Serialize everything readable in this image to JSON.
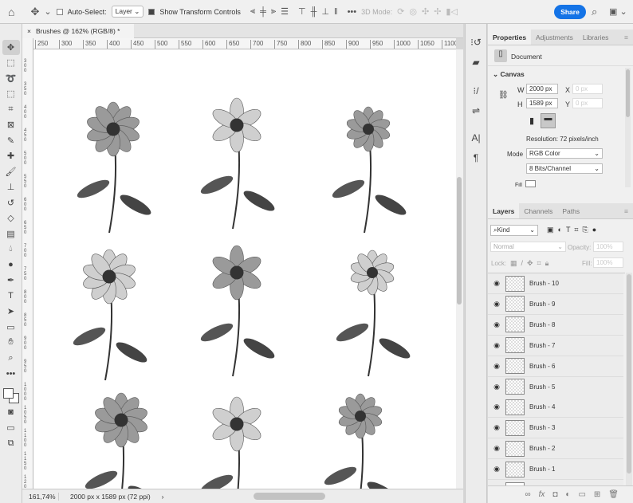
{
  "topbar": {
    "auto_select_label": "Auto-Select:",
    "auto_select_checked": false,
    "layer_select": "Layer",
    "show_transform_label": "Show Transform Controls",
    "show_transform_checked": true,
    "mode_3d_label": "3D Mode:",
    "share_label": "Share"
  },
  "document": {
    "tab_title": "Brushes @ 162% (RGB/8) *",
    "zoom": "161,74%",
    "info": "2000 px x 1589 px (72 ppi)"
  },
  "rulers": {
    "horizontal": [
      "250",
      "300",
      "350",
      "400",
      "450",
      "500",
      "550",
      "600",
      "650",
      "700",
      "750",
      "800",
      "850",
      "900",
      "950",
      "1000",
      "1050",
      "1100"
    ],
    "vertical": [
      "300",
      "350",
      "400",
      "450",
      "500",
      "550",
      "600",
      "650",
      "700",
      "750",
      "800",
      "850",
      "900",
      "950",
      "1000",
      "1050",
      "1100",
      "1150",
      "1200"
    ]
  },
  "tools": [
    "move-icon",
    "marquee-icon",
    "lasso-icon",
    "object-select-icon",
    "crop-icon",
    "frame-icon",
    "eyedropper-icon",
    "healing-icon",
    "brush-icon",
    "stamp-icon",
    "history-brush-icon",
    "eraser-icon",
    "gradient-icon",
    "blur-icon",
    "dodge-icon",
    "pen-icon",
    "type-icon",
    "path-select-icon",
    "rectangle-icon",
    "hand-icon",
    "zoom-icon",
    "more-icon"
  ],
  "properties": {
    "tabs": [
      "Properties",
      "Adjustments",
      "Libraries"
    ],
    "doc_label": "Document",
    "canvas_label": "Canvas",
    "w_label": "W",
    "w_value": "2000 px",
    "h_label": "H",
    "h_value": "1589 px",
    "x_label": "X",
    "x_placeholder": "0 px",
    "y_label": "Y",
    "y_placeholder": "0 px",
    "resolution": "Resolution: 72 pixels/inch",
    "mode_label": "Mode",
    "mode_value": "RGB Color",
    "bits_value": "8 Bits/Channel",
    "fill_label": "Fill"
  },
  "layers": {
    "tabs": [
      "Layers",
      "Channels",
      "Paths"
    ],
    "kind": "Kind",
    "blend": "Normal",
    "opacity_label": "Opacity:",
    "opacity": "100%",
    "lock_label": "Lock:",
    "fill_label": "Fill:",
    "fill": "100%",
    "items": [
      "Brush - 10",
      "Brush - 9",
      "Brush - 8",
      "Brush - 7",
      "Brush - 6",
      "Brush - 5",
      "Brush - 4",
      "Brush - 3",
      "Brush - 2",
      "Brush - 1"
    ]
  },
  "colors": {
    "accent": "#1473e6",
    "panel": "#f0f0f0"
  }
}
